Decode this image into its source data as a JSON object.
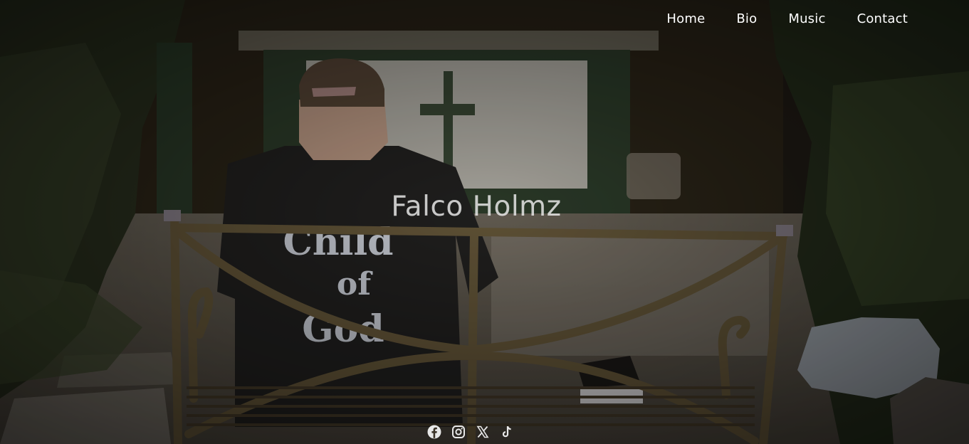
{
  "nav": {
    "items": [
      {
        "label": "Home"
      },
      {
        "label": "Bio"
      },
      {
        "label": "Music"
      },
      {
        "label": "Contact"
      }
    ]
  },
  "hero": {
    "title": "Falco Holmz",
    "background": "photo: man in a cap and black t-shirt seated on an iron bench facing a cross monument in a garden",
    "shirt_text": "Child of God"
  },
  "social": {
    "icons": [
      "facebook-icon",
      "instagram-icon",
      "x-icon",
      "tiktok-icon"
    ]
  },
  "colors": {
    "nav_text": "#ffffff",
    "title_text": "#e6e6e6",
    "icon": "#e8e8e8"
  }
}
